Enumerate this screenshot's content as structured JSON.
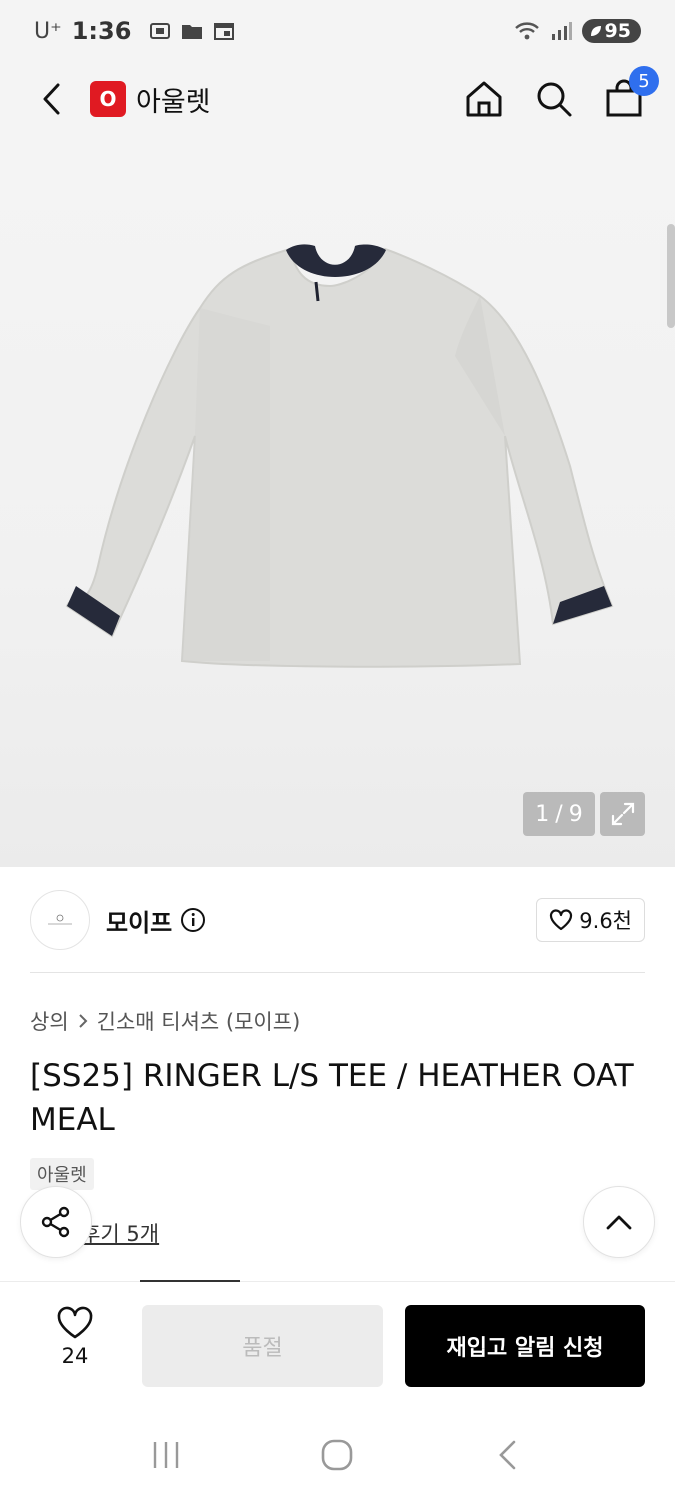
{
  "status_bar": {
    "carrier": "U⁺",
    "time": "1:36",
    "battery": "95"
  },
  "header": {
    "logo_letter": "O",
    "brand": "아울렛",
    "cart_count": "5"
  },
  "gallery": {
    "current": "1",
    "separator": "/",
    "total": "9"
  },
  "brand": {
    "name": "모이프",
    "likes": "9.6천"
  },
  "breadcrumb": {
    "category": "상의",
    "subcategory": "긴소매 티셔츠 (모이프)"
  },
  "product": {
    "title": "[SS25] RINGER L/S TEE / HEATHER OAT MEAL",
    "tag": "아울렛"
  },
  "review": {
    "score": "5",
    "label": "후기 5개"
  },
  "action_bar": {
    "wish_count": "24",
    "soldout_label": "품절",
    "restock_label": "재입고 알림 신청"
  },
  "colors": {
    "accent_red": "#e01a22",
    "badge_blue": "#2f6fee",
    "primary_button": "#000000"
  },
  "icons": [
    "back-arrow-icon",
    "home-icon",
    "search-icon",
    "bag-icon",
    "expand-icon",
    "info-icon",
    "heart-icon",
    "share-icon",
    "chevron-up-icon",
    "recent-apps-icon",
    "home-circle-icon",
    "system-back-icon"
  ]
}
